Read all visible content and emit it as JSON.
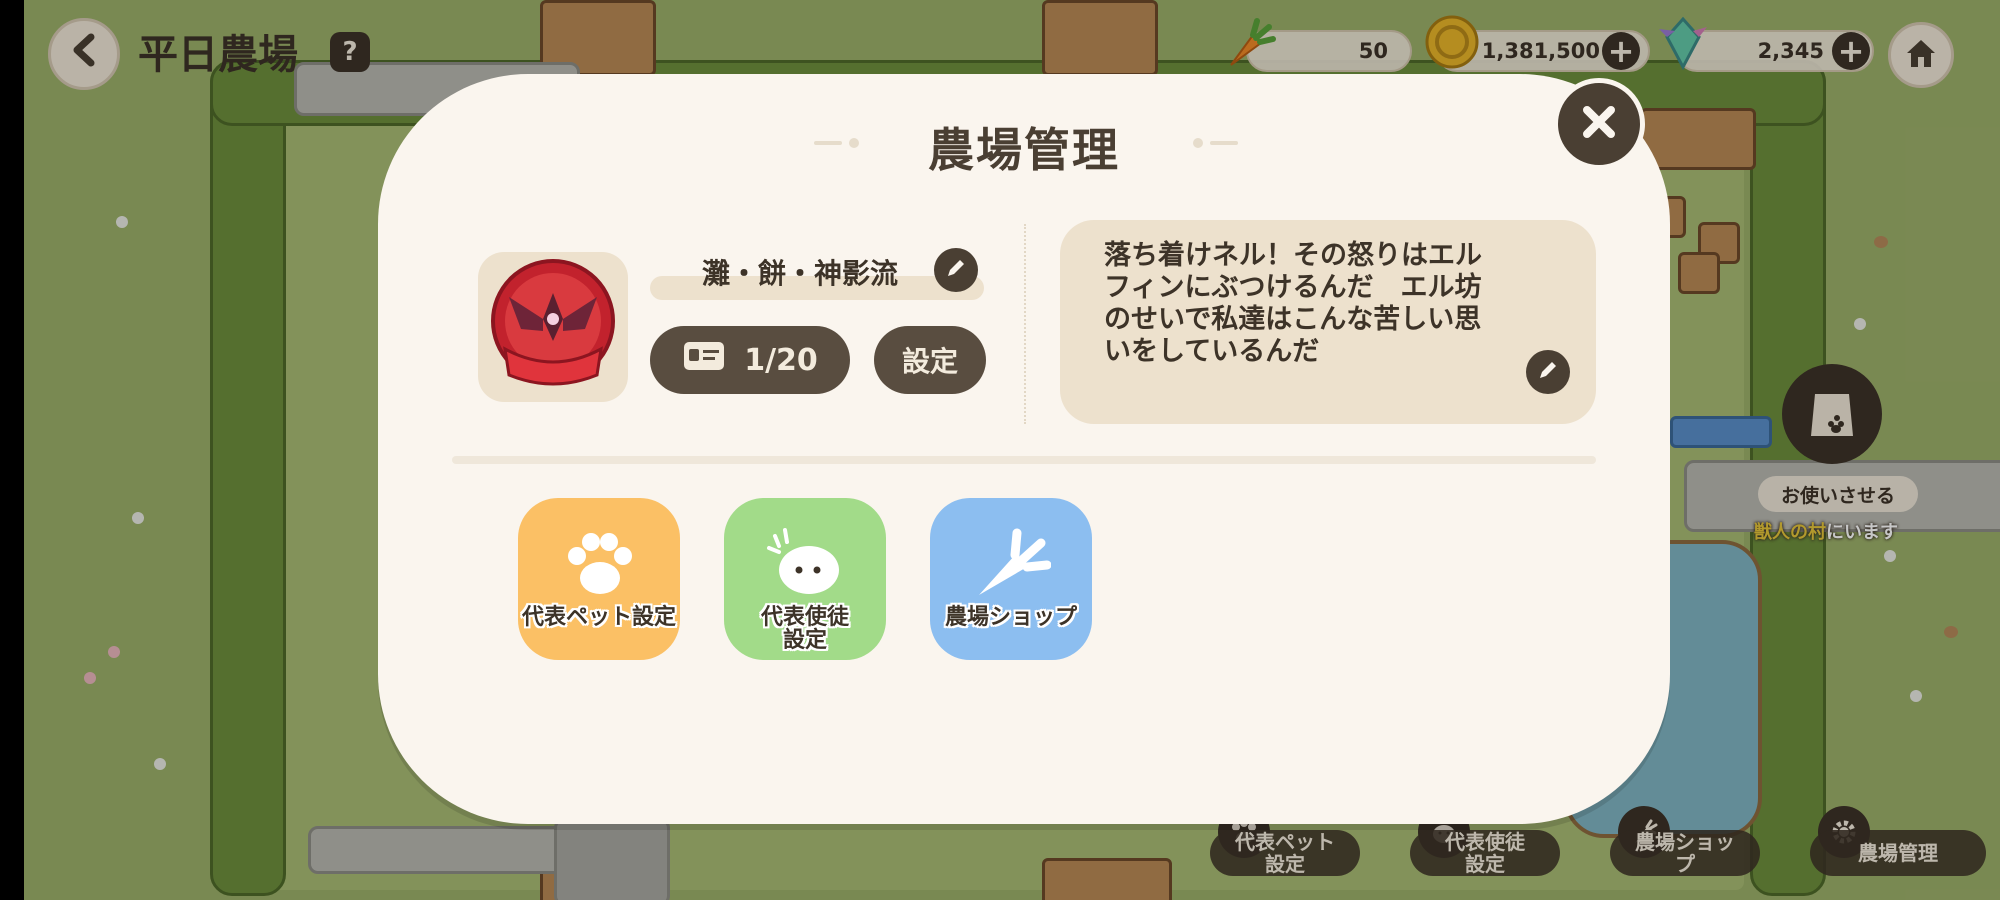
{
  "hud": {
    "back_icon": "chevron-left-icon",
    "farm_name": "平日農場",
    "help_icon": "question-book-icon",
    "resources": [
      {
        "name": "carrot",
        "icon": "carrot-icon",
        "value": "50"
      },
      {
        "name": "coin",
        "icon": "coin-icon",
        "value": "1,381,500",
        "add_icon": "plus-icon"
      },
      {
        "name": "crystal",
        "icon": "crystal-icon",
        "value": "2,345",
        "add_icon": "plus-icon"
      }
    ],
    "home_icon": "home-icon"
  },
  "side": {
    "bag_icon": "paw-bag-icon",
    "errand_label": "お使いさせる",
    "village_highlight": "獣人の村",
    "village_suffix": "にいます"
  },
  "bottom_bar": [
    {
      "label": "代表ペット\n設定",
      "icon": "paw-icon"
    },
    {
      "label": "代表使徒\n設定",
      "icon": "pet-face-icon"
    },
    {
      "label": "農場ショッ\nプ",
      "icon": "carrot-icon"
    },
    {
      "label": "農場管理",
      "icon": "gear-icon"
    }
  ],
  "modal": {
    "title": "農場管理",
    "close_icon": "close-icon",
    "emblem_icon": "red-emblem-icon",
    "farm_name": "灘・餅・神影流",
    "edit_icon": "pencil-icon",
    "member_icon": "id-card-icon",
    "member_count": "1/20",
    "settings_label": "設定",
    "motto": "落ち着けネル！その怒りはエル\nフィンにぶつけるんだ　エル坊\nのせいで私達はこんな苦しい思\nいをしているんだ",
    "features": [
      {
        "label": "代表ペット設定",
        "icon": "paw-icon",
        "color": "#fbc065"
      },
      {
        "label": "代表使徒\n設定",
        "icon": "pet-face-icon",
        "color": "#a2db89"
      },
      {
        "label": "農場ショップ",
        "icon": "carrot-icon",
        "color": "#8cbef0"
      }
    ]
  },
  "colors": {
    "modal_bg": "#faf5ee",
    "dark_brown": "#4a3f33",
    "beige": "#ede1cd"
  }
}
